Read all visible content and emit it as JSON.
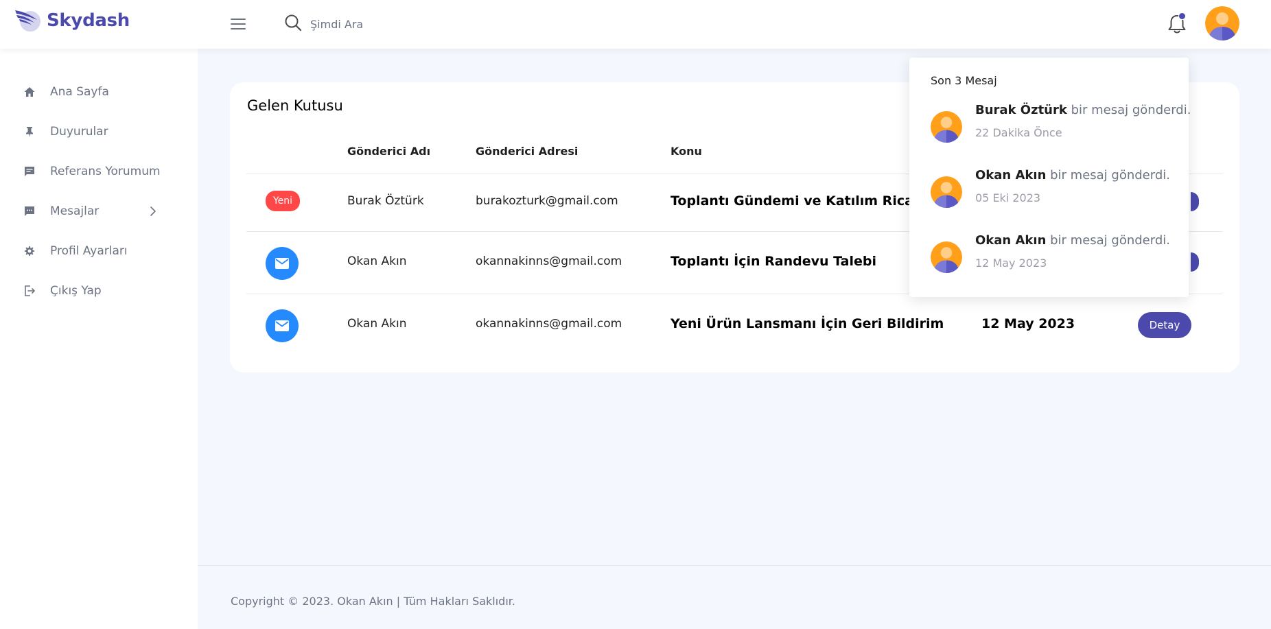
{
  "brand": {
    "name": "Skydash"
  },
  "search": {
    "placeholder": "Şimdi Ara"
  },
  "sidebar": {
    "items": [
      {
        "label": "Ana Sayfa",
        "icon": "home-icon"
      },
      {
        "label": "Duyurular",
        "icon": "pin-icon"
      },
      {
        "label": "Referans Yorumum",
        "icon": "comment-icon"
      },
      {
        "label": "Mesajlar",
        "icon": "message-icon"
      },
      {
        "label": "Profil Ayarları",
        "icon": "gear-icon"
      },
      {
        "label": "Çıkış Yap",
        "icon": "logout-icon"
      }
    ]
  },
  "inbox": {
    "title": "Gelen Kutusu",
    "headers": [
      "Gönderici Adı",
      "Gönderici Adresi",
      "Konu"
    ],
    "rows": [
      {
        "badge": "Yeni",
        "name": "Burak Öztürk",
        "email": "burakozturk@gmail.com",
        "subject": "Toplantı Gündemi ve Katılım Ricası",
        "date": "",
        "action": ""
      },
      {
        "badge": "",
        "name": "Okan Akın",
        "email": "okannakinns@gmail.com",
        "subject": "Toplantı İçin Randevu Talebi",
        "date": "",
        "action": ""
      },
      {
        "badge": "",
        "name": "Okan Akın",
        "email": "okannakinns@gmail.com",
        "subject": "Yeni Ürün Lansmanı İçin Geri Bildirim",
        "date": "12 May 2023",
        "action": "Detay"
      }
    ]
  },
  "notifications": {
    "title": "Son 3 Mesaj",
    "items": [
      {
        "sender": "Burak Öztürk",
        "text": " bir mesaj gönderdi.",
        "time": "22 Dakika Önce"
      },
      {
        "sender": "Okan Akın",
        "text": " bir mesaj gönderdi.",
        "time": "05 Eki 2023"
      },
      {
        "sender": "Okan Akın",
        "text": " bir mesaj gönderdi.",
        "time": "12 May 2023"
      }
    ]
  },
  "footer": {
    "text": "Copyright © 2023. Okan Akın | Tüm Hakları Saklıdır."
  },
  "colors": {
    "accent": "#4B49AC",
    "badge_red": "#FF4747",
    "mail_blue": "#248AFD",
    "avatar_orange": "#FF9F1A"
  }
}
